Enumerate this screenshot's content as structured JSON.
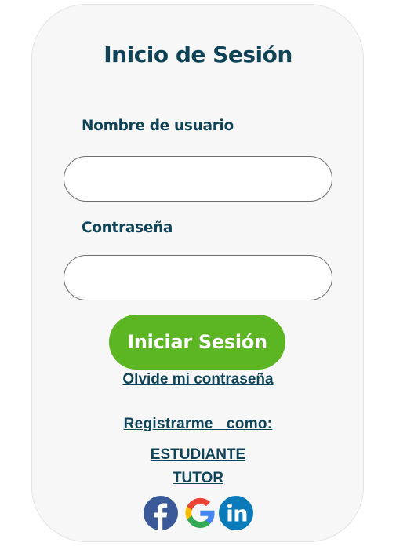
{
  "login": {
    "title": "Inicio de Sesión",
    "username_label": "Nombre de usuario",
    "username_value": "",
    "password_label": "Contraseña",
    "password_value": "",
    "submit_label": "Iniciar Sesión",
    "forgot_link": "Olvide mi contraseña"
  },
  "register": {
    "heading": "Registrarme  como:",
    "options": [
      "ESTUDIANTE",
      "TUTOR"
    ]
  },
  "social": {
    "icons": [
      "facebook-icon",
      "google-icon",
      "linkedin-icon"
    ]
  },
  "colors": {
    "primary_text": "#0f4357",
    "button_green": "#5cb522",
    "card_background": "#f7f7f7",
    "facebook_blue": "#3b5998",
    "linkedin_blue": "#0a7bb8"
  }
}
